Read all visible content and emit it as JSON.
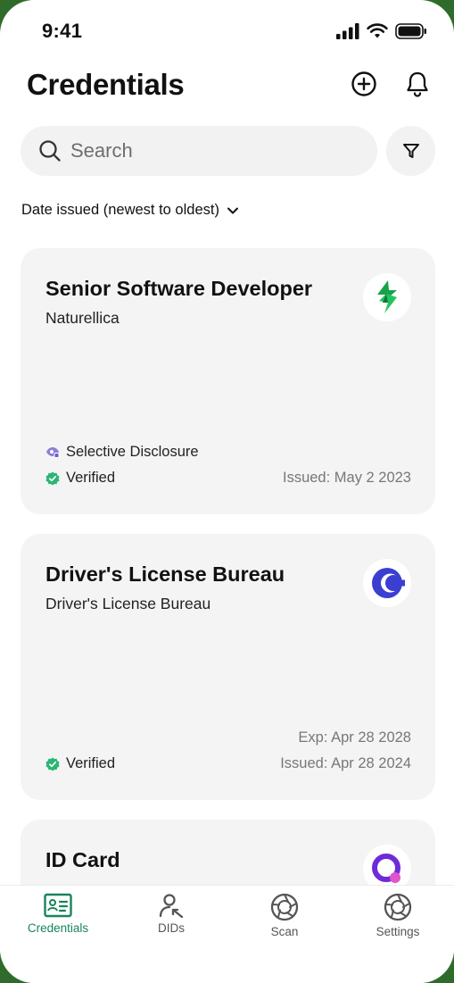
{
  "status_bar": {
    "time": "9:41"
  },
  "header": {
    "title": "Credentials"
  },
  "search": {
    "placeholder": "Search"
  },
  "sort": {
    "label": "Date issued (newest to oldest)"
  },
  "credentials": [
    {
      "title": "Senior Software Developer",
      "issuer": "Naturellica",
      "logo_icon": "green-bolt-logo",
      "selective_disclosure": "Selective Disclosure",
      "status": "Verified",
      "issued": "Issued: May 2 2023"
    },
    {
      "title": "Driver's License Bureau",
      "issuer": "Driver's License Bureau",
      "logo_icon": "blue-c-logo",
      "status": "Verified",
      "expiry": "Exp: Apr 28 2028",
      "issued": "Issued: Apr 28 2024"
    },
    {
      "title": "ID Card",
      "logo_icon": "purple-q-logo"
    }
  ],
  "tabs": [
    {
      "label": "Credentials",
      "icon": "id-card-icon",
      "active": true
    },
    {
      "label": "DIDs",
      "icon": "person-arrow-icon"
    },
    {
      "label": "Scan",
      "icon": "aperture-icon"
    },
    {
      "label": "Settings",
      "icon": "aperture-icon"
    }
  ],
  "colors": {
    "accent": "#17855a",
    "verified": "#2bb673",
    "selective": "#8b7fd6"
  }
}
